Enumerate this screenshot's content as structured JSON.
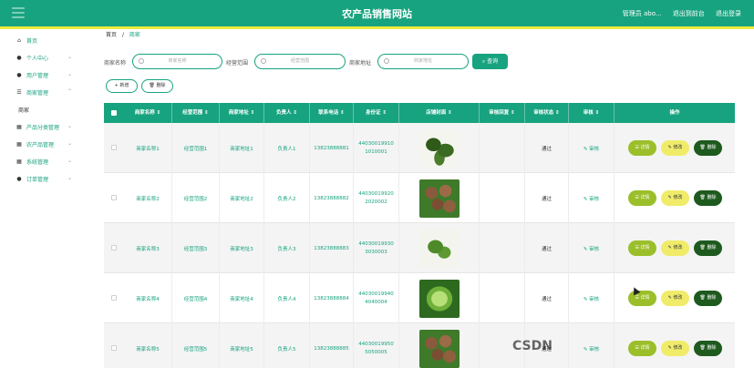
{
  "header": {
    "title": "农产品销售网站",
    "user": "管理员 abo...",
    "back_to_frontend": "退出到前台",
    "logout": "退出登录"
  },
  "sidebar": {
    "items": [
      {
        "label": "首页",
        "icon": "home-icon"
      },
      {
        "label": "个人中心",
        "icon": "user-icon"
      },
      {
        "label": "用户管理",
        "icon": "user-icon"
      },
      {
        "label": "商家管理",
        "icon": "sliders-icon"
      },
      {
        "label": "商家",
        "icon": ""
      },
      {
        "label": "产品分类管理",
        "icon": "grid-icon"
      },
      {
        "label": "农产品管理",
        "icon": "grid-icon"
      },
      {
        "label": "系统管理",
        "icon": "grid-icon"
      },
      {
        "label": "订单管理",
        "icon": "user-icon"
      }
    ]
  },
  "breadcrumb": {
    "home": "首页",
    "separator": "/",
    "current": "商家"
  },
  "search": {
    "fields": [
      {
        "label": "商家名称",
        "placeholder": "商家名称"
      },
      {
        "label": "经营范围",
        "placeholder": "经营范围"
      },
      {
        "label": "商家地址",
        "placeholder": "商家地址"
      }
    ],
    "button": "查询"
  },
  "actions": {
    "add": "+ 新增",
    "delete": "删除"
  },
  "table": {
    "headers": [
      "商家名称 ⇕",
      "经营范围 ⇕",
      "商家地址 ⇕",
      "负责人 ⇕",
      "联系电话 ⇕",
      "身份证 ⇕",
      "店铺封面 ⇕",
      "审核回复 ⇕",
      "审核状态 ⇕",
      "审核 ⇕",
      "操作"
    ],
    "rows": [
      {
        "name": "商家名称1",
        "scope": "经营范围1",
        "address": "商家地址1",
        "owner": "负责人1",
        "phone": "13823888881",
        "id_line1": "44030019910",
        "id_line2": "1010001",
        "reply": "",
        "status": "通过",
        "review": "审核",
        "image": "cucumber"
      },
      {
        "name": "商家名称2",
        "scope": "经营范围2",
        "address": "商家地址2",
        "owner": "负责人2",
        "phone": "13823888882",
        "id_line1": "44030019920",
        "id_line2": "2020002",
        "reply": "",
        "status": "通过",
        "review": "审核",
        "image": "onions"
      },
      {
        "name": "商家名称3",
        "scope": "经营范围3",
        "address": "商家地址3",
        "owner": "负责人3",
        "phone": "13823888883",
        "id_line1": "44030019930",
        "id_line2": "3030003",
        "reply": "",
        "status": "通过",
        "review": "审核",
        "image": "beans"
      },
      {
        "name": "商家名称4",
        "scope": "经营范围4",
        "address": "商家地址4",
        "owner": "负责人4",
        "phone": "13823888884",
        "id_line1": "44030019940",
        "id_line2": "4040004",
        "reply": "",
        "status": "通过",
        "review": "审核",
        "image": "cabbage"
      },
      {
        "name": "商家名称5",
        "scope": "经营范围5",
        "address": "商家地址5",
        "owner": "负责人5",
        "phone": "13823888885",
        "id_line1": "44030019950",
        "id_line2": "5050005",
        "reply": "",
        "status": "通过",
        "review": "审核",
        "image": "onions"
      }
    ],
    "row_buttons": {
      "detail": "详情",
      "edit": "修改",
      "delete": "删除"
    }
  },
  "overlay": {
    "timestamp": "04:22",
    "watermark": "CSDN"
  },
  "colors": {
    "primary": "#17a37f",
    "accent_bar": "#ecec3e",
    "detail": "#9bbf2a",
    "edit": "#f0ec6a",
    "delete": "#1e5a1e"
  }
}
